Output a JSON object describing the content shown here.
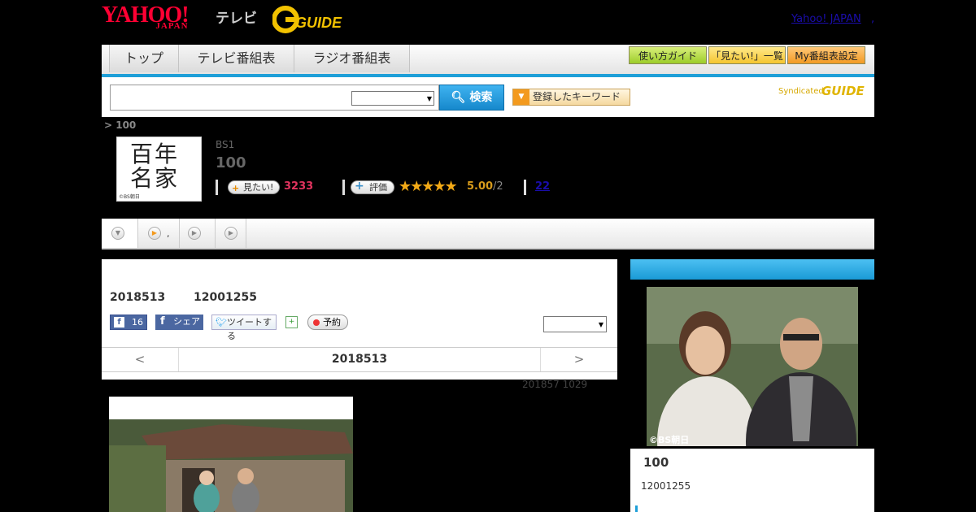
{
  "header": {
    "yahoo_logo": "YAHOO!",
    "yahoo_logo_sub": "JAPAN",
    "tv_label": "テレビ",
    "gguide_logo": "GUIDE",
    "yahoo_japan_link": "Yahoo! JAPAN",
    "link_sep": ","
  },
  "nav": {
    "tabs": [
      "トップ",
      "テレビ番組表",
      "ラジオ番組表"
    ],
    "buttons": [
      "使い方ガイド",
      "「見たい!」一覧",
      "My番組表設定"
    ]
  },
  "search": {
    "input_value": "",
    "select_value": "",
    "button_label": "検索",
    "keyword_button": "登録したキーワード",
    "syndicated": "Syndicated",
    "syndicated_logo": "GUIDE"
  },
  "program": {
    "breadcrumb": "> 100",
    "thumb_text": "百年名家",
    "thumb_credit": "©BS朝日",
    "channel": "BS1",
    "title": "100",
    "want_label": "見たい!",
    "want_count": "3233",
    "rate_label": "評価",
    "stars": "★★★★★",
    "score": "5.00",
    "score_count": "/2",
    "reviews": "22"
  },
  "tabs": {
    "items": [
      "",
      ",",
      "",
      ""
    ]
  },
  "main": {
    "air_date": "2018513",
    "air_time": "12001255",
    "fb_like_count": "16",
    "fb_share": "シェア",
    "tweet": "ツイートする",
    "reserve": "予約",
    "select_value": "",
    "pager_prev": "<",
    "pager_date": "2018513",
    "pager_next": ">",
    "updated": "201857  1029"
  },
  "side": {
    "image_credit": "©BS朝日",
    "title": "100",
    "time": "12001255"
  },
  "colors": {
    "accent_blue": "#1e9fd8",
    "want_pink": "#e0335e",
    "star_orange": "#f2a916"
  }
}
